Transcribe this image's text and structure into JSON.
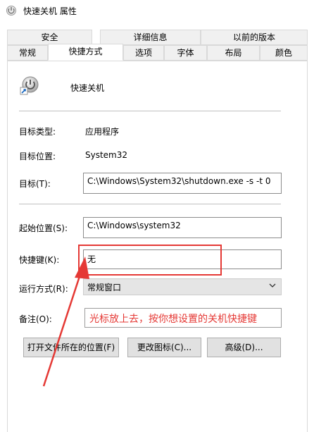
{
  "window": {
    "title": "快速关机 属性"
  },
  "tabs": {
    "row1": [
      "安全",
      "详细信息",
      "以前的版本"
    ],
    "row2": [
      "常规",
      "快捷方式",
      "选项",
      "字体",
      "布局",
      "颜色"
    ],
    "active": "快捷方式"
  },
  "shortcut": {
    "name": "快速关机",
    "icon": "shutdown-shortcut-icon",
    "target_type_label": "目标类型:",
    "target_type_value": "应用程序",
    "target_location_label": "目标位置:",
    "target_location_value": "System32",
    "target_label": "目标(T):",
    "target_value": "C:\\Windows\\System32\\shutdown.exe -s -t 0",
    "start_in_label": "起始位置(S):",
    "start_in_value": "C:\\Windows\\system32",
    "hotkey_label": "快捷键(K):",
    "hotkey_value": "无",
    "run_label": "运行方式(R):",
    "run_value": "常规窗口",
    "comment_label": "备注(O):",
    "comment_value": "光标放上去，按你想设置的关机快捷键"
  },
  "buttons": {
    "open_location": "打开文件所在的位置(F)",
    "change_icon": "更改图标(C)...",
    "advanced": "高级(D)..."
  },
  "colors": {
    "annotation": "#e53935",
    "tab_border": "#d9d9d9",
    "tab_inactive_bg": "#f0f0f0"
  }
}
